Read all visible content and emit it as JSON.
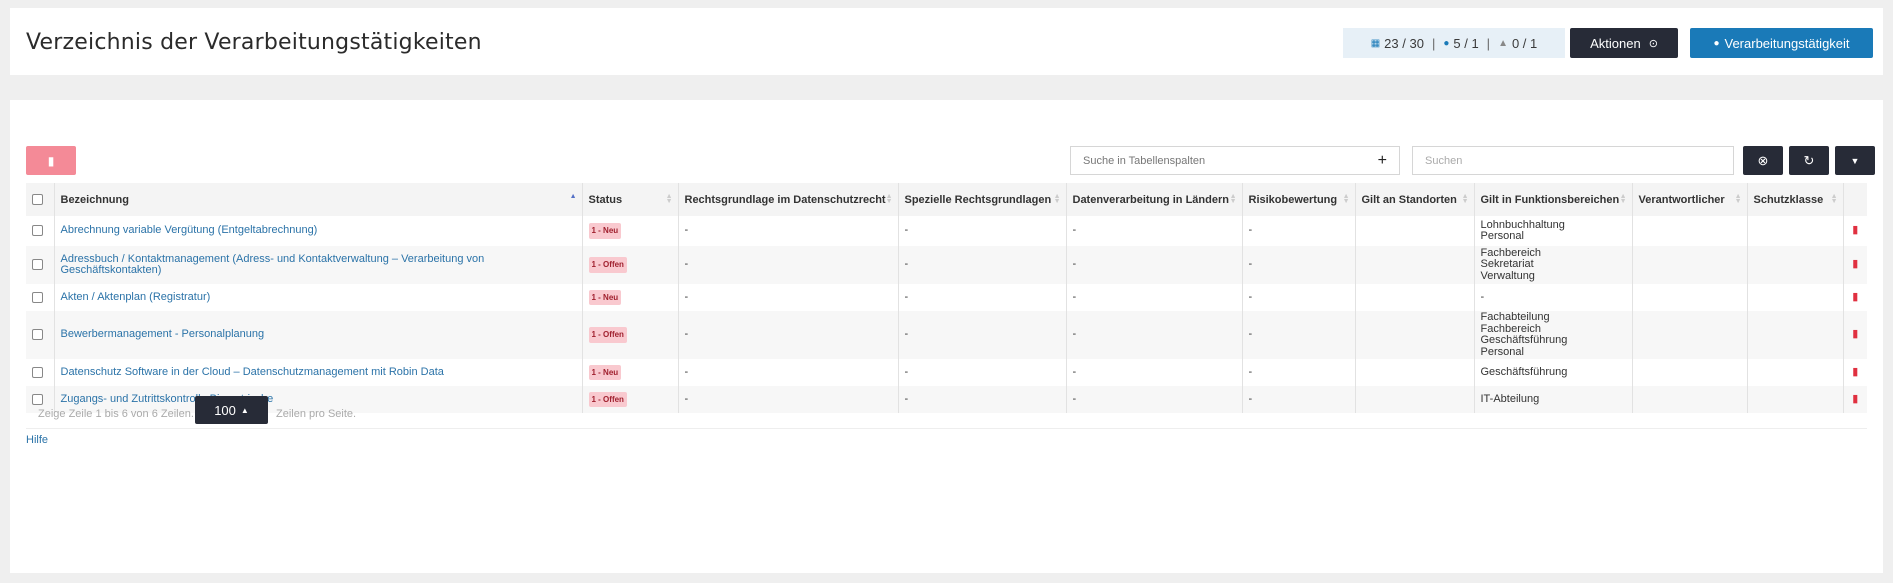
{
  "header": {
    "title": "Verzeichnis der Verarbeitungstätigkeiten",
    "stats": {
      "a": "23 / 30",
      "b": "5 / 1",
      "c": "0 / 1",
      "sep": "|"
    },
    "aktionen_label": "Aktionen",
    "new_label": "Verarbeitungstätigkeit"
  },
  "toolbar": {
    "col_search_placeholder": "Suche in Tabellenspalten",
    "col_search_plus": "+",
    "search_placeholder": "Suchen"
  },
  "table": {
    "columns": [
      "Bezeichnung",
      "Status",
      "Rechtsgrundlage im Datenschutzrecht",
      "Spezielle Rechtsgrundlagen",
      "Datenverarbeitung in Ländern",
      "Risikobewertung",
      "Gilt an Standorten",
      "Gilt in Funktionsbereichen",
      "Verantwortlicher",
      "Schutzklasse"
    ],
    "rows": [
      {
        "name": "Abrechnung variable Vergütung (Entgeltabrechnung)",
        "status": "1 - Neu",
        "r1": "-",
        "r2": "-",
        "r3": "-",
        "r4": "-",
        "r5": "",
        "bereiche": [
          "Lohnbuchhaltung",
          "Personal"
        ],
        "r7": "",
        "r8": ""
      },
      {
        "name": "Adressbuch / Kontaktmanagement (Adress- und Kontaktverwaltung – Verarbeitung von Geschäftskontakten)",
        "status": "1 - Offen",
        "r1": "-",
        "r2": "-",
        "r3": "-",
        "r4": "-",
        "r5": "",
        "bereiche": [
          "Fachbereich",
          "Sekretariat",
          "Verwaltung"
        ],
        "r7": "",
        "r8": ""
      },
      {
        "name": "Akten / Aktenplan (Registratur)",
        "status": "1 - Neu",
        "r1": "-",
        "r2": "-",
        "r3": "-",
        "r4": "-",
        "r5": "",
        "bereiche": [
          "-"
        ],
        "r7": "",
        "r8": ""
      },
      {
        "name": "Bewerbermanagement - Personalplanung",
        "status": "1 - Offen",
        "r1": "-",
        "r2": "-",
        "r3": "-",
        "r4": "-",
        "r5": "",
        "bereiche": [
          "Fachabteilung",
          "Fachbereich",
          "Geschäftsführung",
          "Personal"
        ],
        "r7": "",
        "r8": ""
      },
      {
        "name": "Datenschutz Software in der Cloud – Datenschutzmanagement mit Robin Data",
        "status": "1 - Neu",
        "r1": "-",
        "r2": "-",
        "r3": "-",
        "r4": "-",
        "r5": "",
        "bereiche": [
          "Geschäftsführung"
        ],
        "r7": "",
        "r8": ""
      },
      {
        "name": "Zugangs- und Zutrittskontrolle Biometrische",
        "status": "1 - Offen",
        "r1": "-",
        "r2": "-",
        "r3": "-",
        "r4": "-",
        "r5": "",
        "bereiche": [
          "IT-Abteilung"
        ],
        "r7": "",
        "r8": ""
      }
    ]
  },
  "footer": {
    "info": "Zeige Zeile 1 bis 6 von 6 Zeilen.",
    "per_page": "100",
    "per_page_label": "Zeilen pro Seite.",
    "help": "Hilfe"
  },
  "icons": {
    "counts": "list-icon",
    "locations": "location-pin-icon",
    "persons": "person-icon",
    "aktionen": "chevron-circle-icon",
    "new": "plus-circle-icon",
    "delete": "trash-icon",
    "clear": "clear-icon",
    "refresh": "refresh-icon",
    "menu": "caret-down-icon"
  },
  "colors": {
    "accent": "#1a7ab8",
    "dark": "#272b37",
    "danger": "#f48a97",
    "badge_bg": "#f9c9cf"
  }
}
